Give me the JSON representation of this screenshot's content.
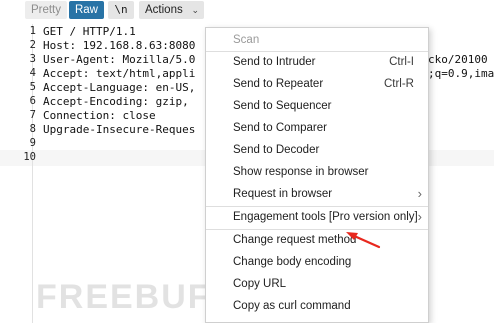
{
  "toolbar": {
    "pretty_label": "Pretty",
    "raw_label": "Raw",
    "newline_label": "\\n",
    "actions_label": "Actions",
    "actions_chevron": "⌄"
  },
  "editor": {
    "line_numbers": [
      "1",
      "2",
      "3",
      "4",
      "5",
      "6",
      "7",
      "8",
      "9",
      "10"
    ],
    "lines": [
      "GET / HTTP/1.1",
      "Host: 192.168.8.63:8080",
      "User-Agent: Mozilla/5.0",
      "Accept: text/html,appli",
      "Accept-Language: en-US,",
      "Accept-Encoding: gzip,",
      "Connection: close",
      "Upgrade-Insecure-Reques",
      "",
      ""
    ],
    "overflow_right": {
      "line3": "cko/20100",
      "line4": ";q=0.9,ima"
    }
  },
  "context_menu": {
    "items": [
      {
        "label": "Scan",
        "disabled": true
      },
      {
        "label": "Send to Intruder",
        "shortcut": "Ctrl-I"
      },
      {
        "label": "Send to Repeater",
        "shortcut": "Ctrl-R"
      },
      {
        "label": "Send to Sequencer"
      },
      {
        "label": "Send to Comparer"
      },
      {
        "label": "Send to Decoder"
      },
      {
        "label": "Show response in browser"
      },
      {
        "label": "Request in browser",
        "submenu": "›"
      },
      {
        "label": "Engagement tools [Pro version only]",
        "submenu": "›"
      },
      {
        "label": "Change request method"
      },
      {
        "label": "Change body encoding"
      },
      {
        "label": "Copy URL"
      },
      {
        "label": "Copy as curl command"
      }
    ]
  },
  "watermark": {
    "text": "FREEBUF"
  },
  "colors": {
    "accent": "#2873a6",
    "arrow": "#e8281e"
  }
}
